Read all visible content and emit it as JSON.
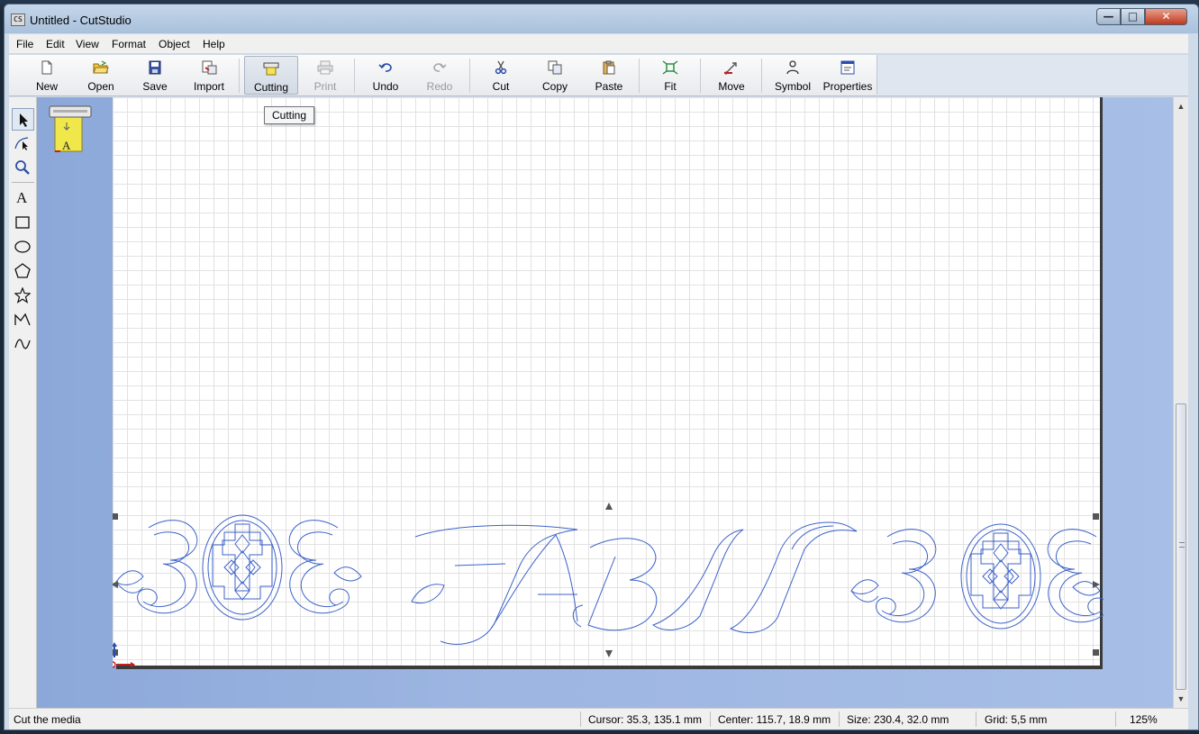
{
  "window": {
    "title": "Untitled - CutStudio",
    "app_icon_text": "CS",
    "controls": {
      "minimize": "—",
      "maximize": "□",
      "close": "✕"
    }
  },
  "menu": [
    "File",
    "Edit",
    "View",
    "Format",
    "Object",
    "Help"
  ],
  "toolbar": {
    "buttons": [
      {
        "label": "New",
        "icon": "new-document-icon"
      },
      {
        "label": "Open",
        "icon": "open-folder-icon"
      },
      {
        "label": "Save",
        "icon": "save-disk-icon"
      },
      {
        "label": "Import",
        "icon": "import-icon"
      },
      {
        "label": "Cutting",
        "icon": "cutter-icon",
        "state": "pressed"
      },
      {
        "label": "Print",
        "icon": "printer-icon",
        "state": "disabled"
      },
      {
        "label": "Undo",
        "icon": "undo-icon"
      },
      {
        "label": "Redo",
        "icon": "redo-icon",
        "state": "disabled"
      },
      {
        "label": "Cut",
        "icon": "scissors-icon"
      },
      {
        "label": "Copy",
        "icon": "copy-icon"
      },
      {
        "label": "Paste",
        "icon": "paste-icon"
      },
      {
        "label": "Fit",
        "icon": "fit-icon"
      },
      {
        "label": "Move",
        "icon": "move-icon"
      },
      {
        "label": "Symbol",
        "icon": "symbol-icon"
      },
      {
        "label": "Properties",
        "icon": "properties-icon"
      }
    ]
  },
  "tooltip": {
    "text": "Cutting"
  },
  "tools": [
    {
      "name": "select-tool",
      "icon": "arrow-pointer-icon",
      "active": true
    },
    {
      "name": "edit-points-tool",
      "icon": "node-edit-icon"
    },
    {
      "name": "zoom-tool",
      "icon": "magnifier-icon"
    },
    {
      "name": "text-tool",
      "icon": "text-a-icon",
      "glyph": "A"
    },
    {
      "name": "rectangle-tool",
      "icon": "rectangle-icon"
    },
    {
      "name": "ellipse-tool",
      "icon": "ellipse-icon"
    },
    {
      "name": "polygon-tool",
      "icon": "pentagon-icon"
    },
    {
      "name": "star-tool",
      "icon": "star-icon"
    },
    {
      "name": "polyline-tool",
      "icon": "polyline-icon"
    },
    {
      "name": "curve-tool",
      "icon": "curve-icon"
    }
  ],
  "canvas": {
    "artwork_text": "FABIT",
    "outline_color": "#3d62c9",
    "grid_color": "#e2e2e2"
  },
  "status": {
    "message": "Cut the media",
    "cursor": "Cursor: 35.3, 135.1 mm",
    "center": "Center: 115.7, 18.9 mm",
    "size": "Size: 230.4, 32.0 mm",
    "grid": "Grid: 5,5 mm",
    "zoom": "125%"
  }
}
